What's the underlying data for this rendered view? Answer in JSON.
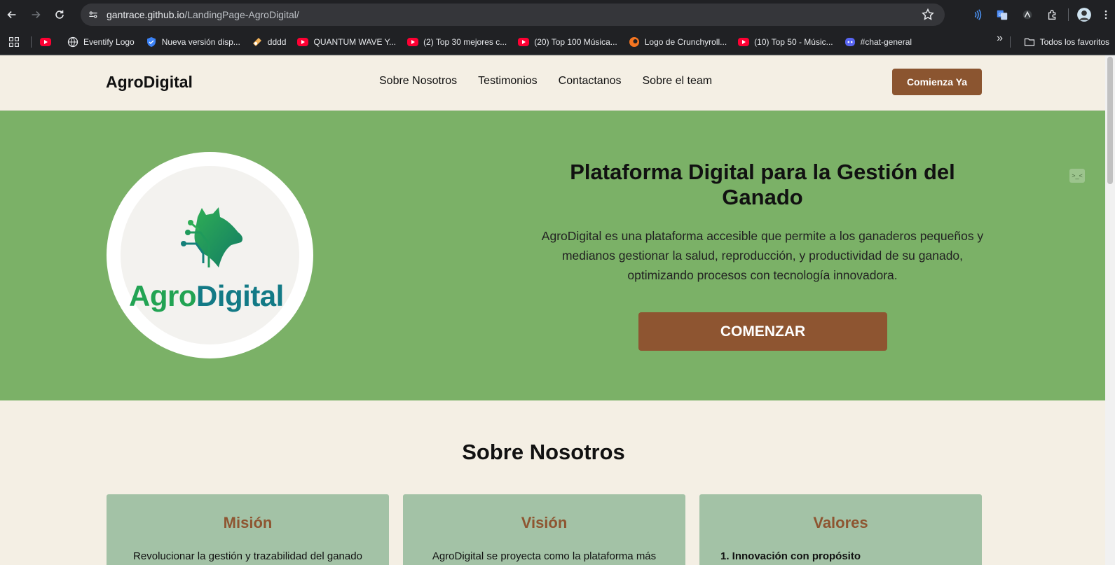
{
  "browser": {
    "url_host": "gantrace.github.io",
    "url_path": "/LandingPage-AgroDigital/",
    "bookmarks": [
      {
        "label": "Eventify Logo",
        "icon": "globe-icon"
      },
      {
        "label": "Nueva versión disp...",
        "icon": "shield-icon"
      },
      {
        "label": "dddd",
        "icon": "bookmark-icon"
      },
      {
        "label": "QUANTUM WAVE Y...",
        "icon": "youtube-icon"
      },
      {
        "label": "(2) Top 30 mejores c...",
        "icon": "youtube-icon"
      },
      {
        "label": "(20) Top 100 Música...",
        "icon": "youtube-icon"
      },
      {
        "label": "Logo de Crunchyroll...",
        "icon": "crunchyroll-icon"
      },
      {
        "label": "(10) Top 50 - Músic...",
        "icon": "youtube-icon"
      },
      {
        "label": "#chat-general",
        "icon": "discord-icon"
      }
    ],
    "all_bookmarks_label": "Todos los favoritos"
  },
  "header": {
    "logo": "AgroDigital",
    "nav": [
      "Sobre Nosotros",
      "Testimonios",
      "Contactanos",
      "Sobre el team"
    ],
    "cta": "Comienza Ya"
  },
  "hero": {
    "logo_agro": "Agro",
    "logo_digital": "Digital",
    "title": "Plataforma Digital para la Gestión del Ganado",
    "description": "AgroDigital es una plataforma accesible que permite a los ganaderos pequeños y medianos gestionar la salud, reproducción, y productividad de su ganado, optimizando procesos con tecnología innovadora.",
    "cta": "COMENZAR"
  },
  "about": {
    "title": "Sobre Nosotros",
    "cards": [
      {
        "title": "Misión",
        "text": "Revolucionar la gestión y trazabilidad del ganado"
      },
      {
        "title": "Visión",
        "text": "AgroDigital se proyecta como la plataforma más"
      },
      {
        "title": "Valores",
        "text": "1. Innovación con propósito"
      }
    ]
  },
  "colors": {
    "hero_bg": "#7bb167",
    "brown": "#8e5531",
    "cream": "#f4efe4",
    "card_bg": "#a3c2a6"
  }
}
